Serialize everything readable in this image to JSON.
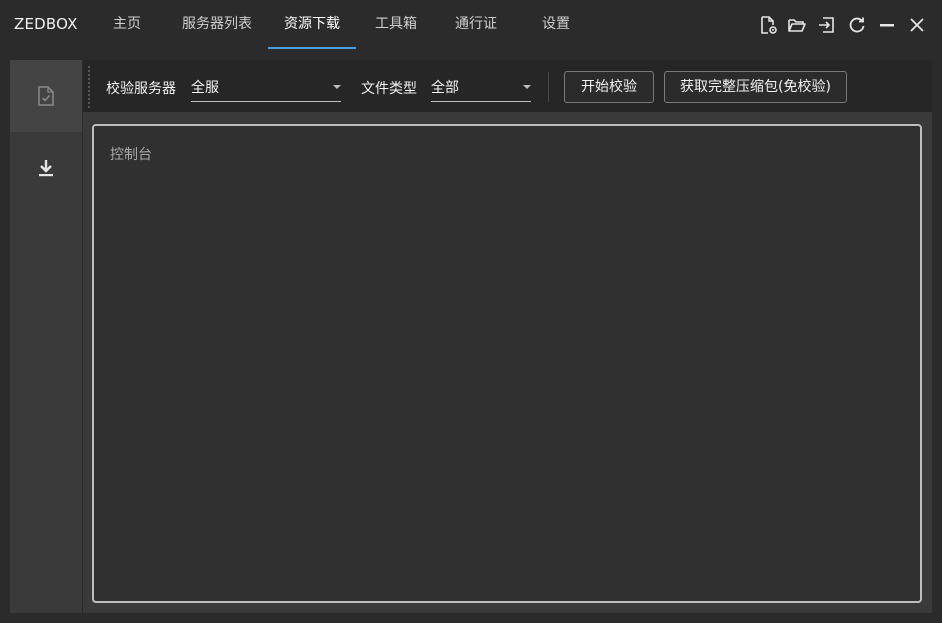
{
  "app": {
    "brand": "ZEDBOX"
  },
  "nav": {
    "tabs": [
      {
        "label": "主页",
        "active": false
      },
      {
        "label": "服务器列表",
        "active": false
      },
      {
        "label": "资源下载",
        "active": true
      },
      {
        "label": "工具箱",
        "active": false
      },
      {
        "label": "通行证",
        "active": false
      },
      {
        "label": "设置",
        "active": false
      }
    ],
    "accent_color": "#4a9be0"
  },
  "window_controls": [
    {
      "icon": "file-settings-icon"
    },
    {
      "icon": "folder-open-icon"
    },
    {
      "icon": "login-icon"
    },
    {
      "icon": "refresh-icon"
    },
    {
      "icon": "minimize-icon"
    },
    {
      "icon": "close-icon"
    }
  ],
  "sidebar": {
    "items": [
      {
        "icon": "file-check-icon",
        "active": true
      },
      {
        "icon": "download-icon",
        "active": false
      }
    ]
  },
  "toolbar": {
    "server_label": "校验服务器",
    "server_value": "全服",
    "filetype_label": "文件类型",
    "filetype_value": "全部",
    "start_button": "开始校验",
    "get_full_button": "获取完整压缩包(免校验)"
  },
  "console": {
    "placeholder": "控制台"
  }
}
